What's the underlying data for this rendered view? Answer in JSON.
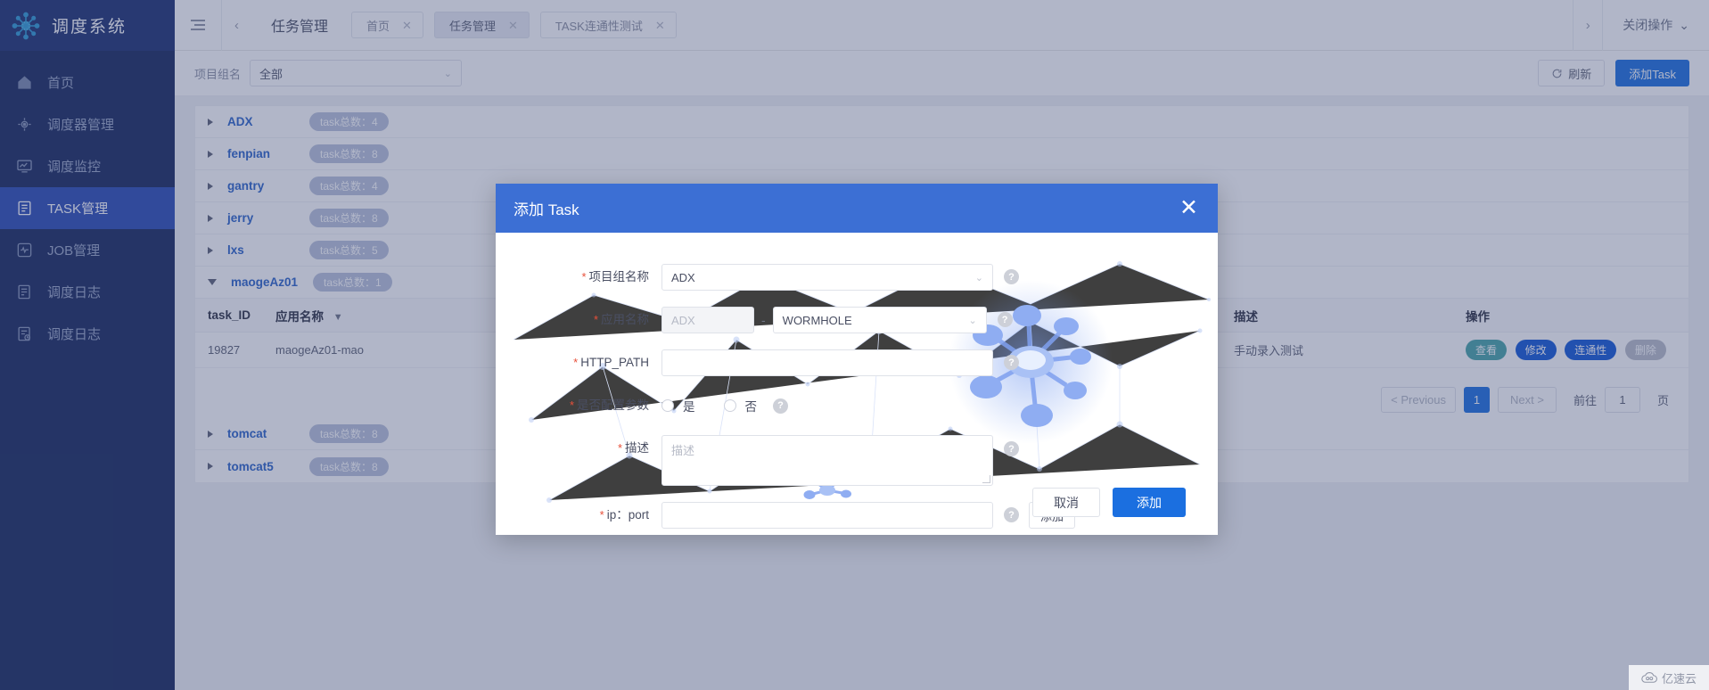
{
  "sidebar": {
    "brand": "调度系统",
    "brand_icon": "network-nodes-icon",
    "items": [
      {
        "label": "首页",
        "icon": "home-icon",
        "active": false
      },
      {
        "label": "调度器管理",
        "icon": "scheduler-icon",
        "active": false
      },
      {
        "label": "调度监控",
        "icon": "monitor-icon",
        "active": false
      },
      {
        "label": "TASK管理",
        "icon": "task-icon",
        "active": true
      },
      {
        "label": "JOB管理",
        "icon": "job-icon",
        "active": false
      },
      {
        "label": "调度日志",
        "icon": "log-icon",
        "active": false
      },
      {
        "label": "调度日志",
        "icon": "log-clock-icon",
        "active": false
      }
    ]
  },
  "topbar": {
    "menu_icon": "hamburger-icon",
    "prev_icon": "chevron-left-icon",
    "next_icon": "chevron-right-icon",
    "page_title": "任务管理",
    "tabs": [
      {
        "label": "首页",
        "close": "✕",
        "active": false
      },
      {
        "label": "任务管理",
        "close": "✕",
        "active": true
      },
      {
        "label": "TASK连通性测试",
        "close": "✕",
        "active": false
      }
    ],
    "close_ops_label": "关闭操作",
    "close_ops_caret": "⌄"
  },
  "filterbar": {
    "label": "项目组名",
    "select_value": "全部",
    "select_caret": "⌄",
    "refresh_label": "刷新",
    "refresh_icon": "refresh-icon",
    "add_task_label": "添加Task"
  },
  "groups": [
    {
      "name": "ADX",
      "badge": "task总数：4",
      "expanded": false
    },
    {
      "name": "fenpian",
      "badge": "task总数：8",
      "expanded": false
    },
    {
      "name": "gantry",
      "badge": "task总数：4",
      "expanded": false
    },
    {
      "name": "jerry",
      "badge": "task总数：8",
      "expanded": false
    },
    {
      "name": "lxs",
      "badge": "task总数：5",
      "expanded": false
    },
    {
      "name": "maogeAz01",
      "badge": "task总数：1",
      "expanded": true
    }
  ],
  "groups_bottom": [
    {
      "name": "tomcat",
      "badge": "task总数：8",
      "expanded": false
    },
    {
      "name": "tomcat5",
      "badge": "task总数：8",
      "expanded": false
    }
  ],
  "task_table": {
    "columns": {
      "id": "task_ID",
      "app": "应用名称",
      "app_filter_icon": "filter-icon",
      "desc": "描述",
      "ops": "操作"
    },
    "rows": [
      {
        "id": "19827",
        "app": "maogeAz01-mao",
        "desc": "手动录入测试",
        "ops": [
          {
            "label": "查看",
            "style": "view"
          },
          {
            "label": "修改",
            "style": "edit"
          },
          {
            "label": "连通性",
            "style": "conn"
          },
          {
            "label": "删除",
            "style": "del"
          }
        ]
      }
    ]
  },
  "pagination": {
    "previous": "< Previous",
    "current": "1",
    "next": "Next >",
    "goto_label": "前往",
    "goto_value": "1",
    "page_unit": "页"
  },
  "modal": {
    "title": "添加 Task",
    "close_icon": "close-icon",
    "fields": {
      "project_group": {
        "label": "项目组名称",
        "required": "*",
        "value": "ADX",
        "caret": "⌄",
        "help_icon": "help-icon"
      },
      "app_name": {
        "label": "应用名称",
        "required": "*",
        "prefix_value": "ADX",
        "separator": "-",
        "value": "WORMHOLE",
        "caret": "⌄",
        "help_icon": "help-icon"
      },
      "http_path": {
        "label": "HTTP_PATH",
        "required": "*",
        "value": "",
        "help_icon": "help-icon"
      },
      "config_params": {
        "label": "是否配置参数",
        "required": "*",
        "option_yes": "是",
        "option_no": "否",
        "help_icon": "help-icon"
      },
      "description": {
        "label": "描述",
        "required": "*",
        "placeholder": "描述",
        "value": "",
        "help_icon": "help-icon"
      },
      "ip_port": {
        "label": "ip：port",
        "required": "*",
        "value": "",
        "add_label": "添加",
        "help_icon": "help-icon"
      }
    },
    "footer": {
      "cancel": "取消",
      "confirm": "添加"
    }
  },
  "watermark": {
    "text": "亿速云",
    "icon": "cloud-icon"
  },
  "colors": {
    "sidebar_bg": "#16275c",
    "sidebar_active": "#2a4bb5",
    "primary": "#1b6fe0",
    "modal_header": "#3c6fd4",
    "group_name": "#2a63c8",
    "badge": "#b9c2da",
    "required": "#e8503a"
  }
}
